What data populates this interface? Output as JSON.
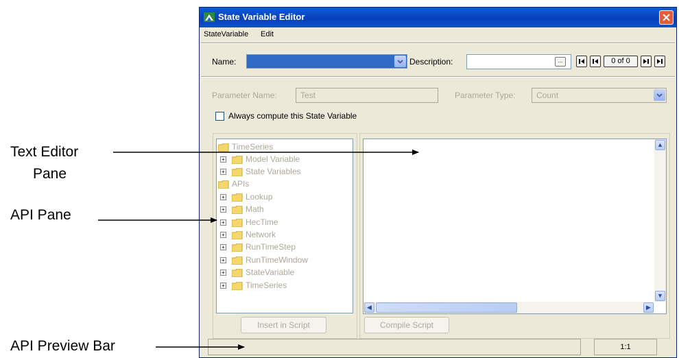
{
  "window": {
    "title": "State Variable Editor"
  },
  "menubar": {
    "items": [
      "StateVariable",
      "Edit"
    ]
  },
  "toolbar": {
    "name_label": "Name:",
    "name_value": "",
    "description_label": "Description:",
    "description_value": "",
    "ellipsis_label": "...",
    "record_counter": "0 of 0"
  },
  "params": {
    "name_label": "Parameter Name:",
    "name_value": "Test",
    "type_label": "Parameter Type:",
    "type_value": "Count"
  },
  "always_compute": {
    "label": "Always compute this State Variable",
    "checked": false
  },
  "api_tree": {
    "nodes": [
      {
        "label": "TimeSeries",
        "level": 0,
        "expandable": false
      },
      {
        "label": "Model Variable",
        "level": 1,
        "expandable": true
      },
      {
        "label": "State Variables",
        "level": 1,
        "expandable": true
      },
      {
        "label": "APIs",
        "level": 0,
        "expandable": false
      },
      {
        "label": "Lookup",
        "level": 1,
        "expandable": true
      },
      {
        "label": "Math",
        "level": 1,
        "expandable": true
      },
      {
        "label": "HecTime",
        "level": 1,
        "expandable": true
      },
      {
        "label": "Network",
        "level": 1,
        "expandable": true
      },
      {
        "label": "RunTimeStep",
        "level": 1,
        "expandable": true
      },
      {
        "label": "RunTimeWindow",
        "level": 1,
        "expandable": true
      },
      {
        "label": "StateVariable",
        "level": 1,
        "expandable": true
      },
      {
        "label": "TimeSeries",
        "level": 1,
        "expandable": true
      }
    ]
  },
  "buttons": {
    "insert_label": "Insert in Script",
    "compile_label": "Compile Script"
  },
  "status": {
    "preview_text": "",
    "position": "1:1"
  },
  "callouts": {
    "text_editor_line1": "Text Editor",
    "text_editor_line2": "Pane",
    "api_pane": "API Pane",
    "api_preview_bar": "API Preview Bar"
  },
  "colors": {
    "titlebar": "#0a52c8",
    "window_bg": "#ece9d8",
    "selection": "#316ac5",
    "close_button": "#e25b3c",
    "folder": "#f5d76e",
    "disabled_text": "#aca899"
  }
}
